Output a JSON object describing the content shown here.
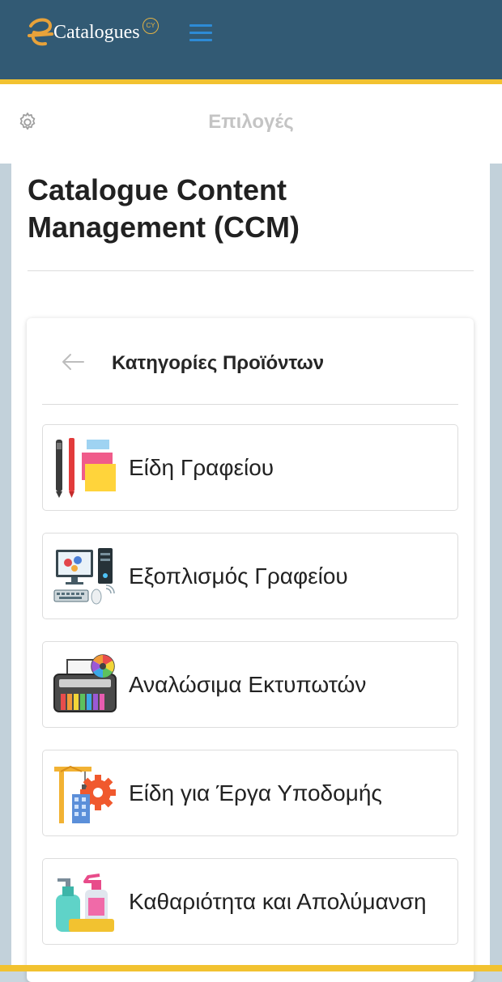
{
  "header": {
    "logo_text": "Catalogues",
    "logo_badge": "CY",
    "menu_icon": "hamburger-menu-icon"
  },
  "options_bar": {
    "label": "Επιλογές",
    "icon": "gear-icon"
  },
  "main": {
    "title": "Catalogue Content Management (CCM)"
  },
  "card": {
    "heading": "Κατηγορίες Προϊόντων",
    "back_icon": "arrow-left-icon",
    "categories": [
      {
        "label": "Είδη Γραφείου",
        "icon": "office-supplies-icon"
      },
      {
        "label": "Εξοπλισμός Γραφείου",
        "icon": "office-equipment-icon"
      },
      {
        "label": "Αναλώσιμα Εκτυπωτών",
        "icon": "printer-consumables-icon"
      },
      {
        "label": "Είδη για Έργα Υποδομής",
        "icon": "infrastructure-works-icon"
      },
      {
        "label": "Καθαριότητα και Απολύμανση",
        "icon": "cleaning-disinfection-icon"
      }
    ]
  },
  "colors": {
    "header_bg": "#325a74",
    "accent_yellow": "#f2c230",
    "menu_blue": "#2d8bd6",
    "page_bg": "#c9d6de"
  }
}
